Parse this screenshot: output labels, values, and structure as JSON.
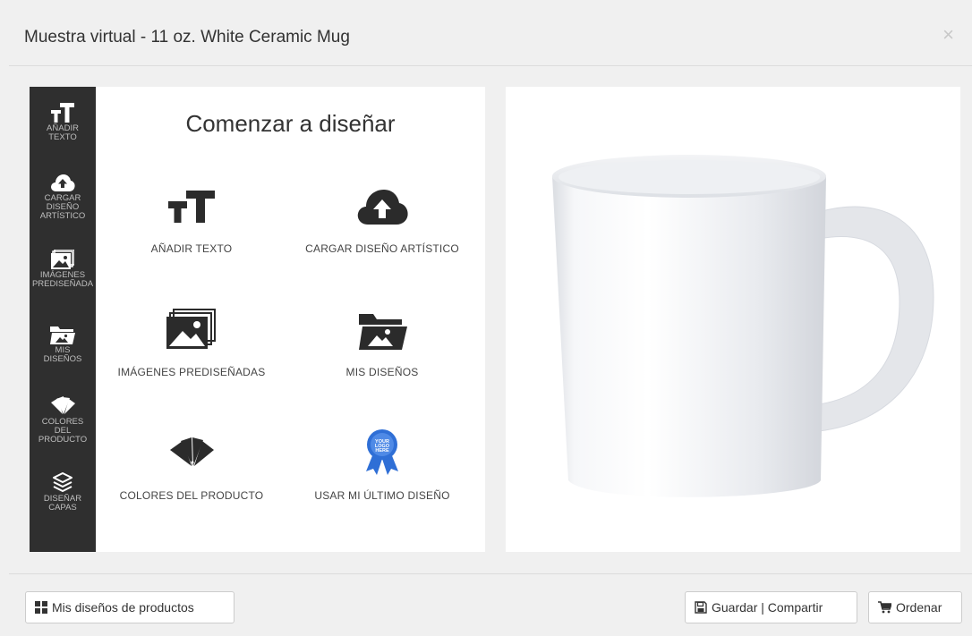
{
  "modal": {
    "title": "Muestra virtual - 11 oz. White Ceramic Mug",
    "close_symbol": "×"
  },
  "sidebar": {
    "items": [
      {
        "label": "AÑADIR\nTEXTO",
        "icon": "text-size-icon"
      },
      {
        "label": "CARGAR\nDISEÑO\nARTÍSTICO",
        "icon": "cloud-upload-icon"
      },
      {
        "label": "IMÁGENES\nPREDISEÑADA",
        "icon": "images-icon"
      },
      {
        "label": "MIS\nDISEÑOS",
        "icon": "folder-image-icon"
      },
      {
        "label": "COLORES\nDEL\nPRODUCTO",
        "icon": "swatches-icon"
      },
      {
        "label": "DISEÑAR\nCAPAS",
        "icon": "layers-icon"
      }
    ]
  },
  "panel": {
    "title": "Comenzar a diseñar",
    "options": [
      {
        "label": "AÑADIR TEXTO",
        "icon": "text-size-icon"
      },
      {
        "label": "CARGAR DISEÑO ARTÍSTICO",
        "icon": "cloud-upload-icon"
      },
      {
        "label": "IMÁGENES PREDISEÑADAS",
        "icon": "images-icon"
      },
      {
        "label": "MIS DISEÑOS",
        "icon": "folder-image-icon"
      },
      {
        "label": "COLORES DEL PRODUCTO",
        "icon": "swatches-icon"
      },
      {
        "label": "USAR MI ÚLTIMO DISEÑO",
        "icon": "award-ribbon-icon",
        "badge_text": "YOUR LOGO HERE"
      }
    ]
  },
  "preview": {
    "product": "11 oz. White Ceramic Mug",
    "image": "white-mug-image"
  },
  "footer": {
    "my_designs_label": "Mis diseños de productos",
    "save_share_label": "Guardar | Compartir",
    "order_label": "Ordenar"
  },
  "colors": {
    "sidebar_bg": "#2f2f2f",
    "ribbon_blue": "#2f6fd6"
  }
}
